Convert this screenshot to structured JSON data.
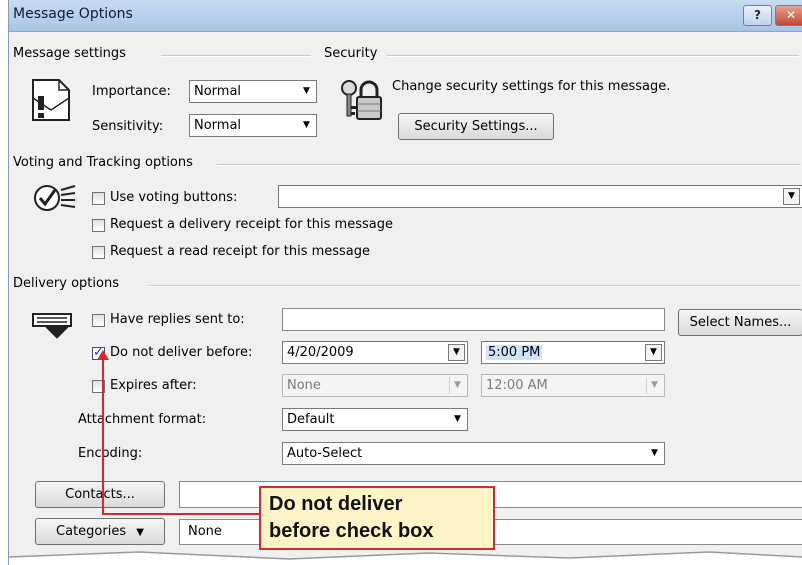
{
  "window": {
    "title": "Message Options",
    "help_glyph": "?",
    "close_glyph": "✕"
  },
  "message_settings": {
    "heading": "Message settings",
    "importance_label": "Importance:",
    "importance_value": "Normal",
    "sensitivity_label": "Sensitivity:",
    "sensitivity_value": "Normal"
  },
  "security": {
    "heading": "Security",
    "text": "Change security settings for this message.",
    "button": "Security Settings..."
  },
  "voting": {
    "heading": "Voting and Tracking options",
    "use_voting_label": "Use voting buttons:",
    "use_voting_value": "",
    "delivery_receipt_label": "Request a delivery receipt for this message",
    "read_receipt_label": "Request a read receipt for this message"
  },
  "delivery": {
    "heading": "Delivery options",
    "replies_label": "Have replies sent to:",
    "replies_value": "",
    "select_names_button": "Select Names...",
    "do_not_deliver_label": "Do not deliver before:",
    "do_not_deliver_checked": true,
    "do_not_deliver_date": "4/20/2009",
    "do_not_deliver_time": "5:00 PM",
    "expires_label": "Expires after:",
    "expires_checked": false,
    "expires_date": "None",
    "expires_time": "12:00 AM",
    "attachment_label": "Attachment format:",
    "attachment_value": "Default",
    "encoding_label": "Encoding:",
    "encoding_value": "Auto-Select"
  },
  "contacts": {
    "button": "Contacts...",
    "value": ""
  },
  "categories": {
    "button": "Categories",
    "value": "None"
  },
  "callout": {
    "line1": "Do not deliver",
    "line2": "before check box"
  },
  "colors": {
    "accent": "#d8272f",
    "callout_bg": "#fff4c7",
    "title_bar": "#b9d1ec"
  }
}
